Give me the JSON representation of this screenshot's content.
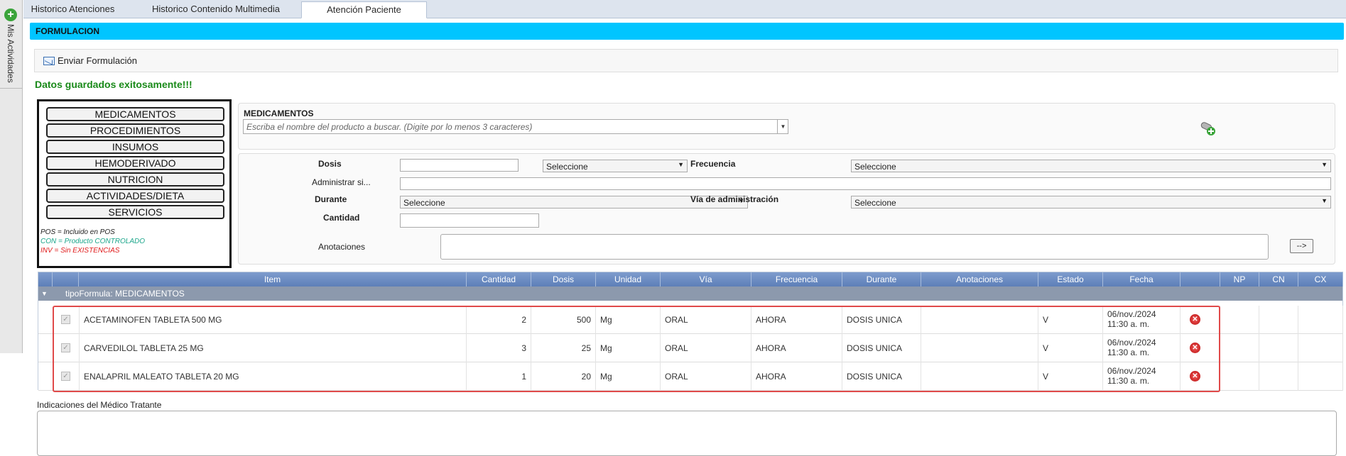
{
  "sidebar": {
    "label": "Mis Actividades"
  },
  "tabs": [
    {
      "label": "Historico Atenciones"
    },
    {
      "label": "Historico Contenido Multimedia"
    },
    {
      "label": "Atención Paciente"
    }
  ],
  "banner": {
    "title": "FORMULACION"
  },
  "toolbar": {
    "send_label": "Enviar Formulación"
  },
  "status": {
    "message": "Datos guardados exitosamente!!!"
  },
  "categories": [
    "MEDICAMENTOS",
    "PROCEDIMIENTOS",
    "INSUMOS",
    "HEMODERIVADO",
    "NUTRICION",
    "ACTIVIDADES/DIETA",
    "SERVICIOS"
  ],
  "legend": {
    "pos": "POS = Incluido en POS",
    "con": "CON = Producto CONTROLADO",
    "inv": "INV = Sin EXISTENCIAS",
    "colors": {
      "pos": "#222222",
      "con": "#1aa58a",
      "inv": "#e01b1b"
    }
  },
  "medicamentos": {
    "title": "MEDICAMENTOS",
    "search_placeholder": "Escriba el nombre del producto a buscar. (Digite por lo menos 3 caracteres)"
  },
  "form": {
    "dosis_label": "Dosis",
    "dosis_unit": "Seleccione",
    "frecuencia_label": "Frecuencia",
    "frecuencia_value": "Seleccione",
    "administrar_label": "Administrar si...",
    "durante_label": "Durante",
    "durante_value": "Seleccione",
    "via_label": "Vía de administración",
    "via_value": "Seleccione",
    "cantidad_label": "Cantidad",
    "anotaciones_label": "Anotaciones",
    "arrow_label": "-->"
  },
  "grid": {
    "headers": [
      "Item",
      "Cantidad",
      "Dosis",
      "Unidad",
      "Vía",
      "Frecuencia",
      "Durante",
      "Anotaciones",
      "Estado",
      "Fecha",
      "NP",
      "CN",
      "CX"
    ],
    "group_label": "tipoFormula: MEDICAMENTOS",
    "rows": [
      {
        "item": "ACETAMINOFEN TABLETA 500 MG",
        "cantidad": "2",
        "dosis": "500",
        "unidad": "Mg",
        "via": "ORAL",
        "frecuencia": "AHORA",
        "durante": "DOSIS UNICA",
        "anotaciones": "",
        "estado": "V",
        "fecha1": "06/nov./2024",
        "fecha2": "11:30 a. m."
      },
      {
        "item": "CARVEDILOL TABLETA 25 MG",
        "cantidad": "3",
        "dosis": "25",
        "unidad": "Mg",
        "via": "ORAL",
        "frecuencia": "AHORA",
        "durante": "DOSIS UNICA",
        "anotaciones": "",
        "estado": "V",
        "fecha1": "06/nov./2024",
        "fecha2": "11:30 a. m."
      },
      {
        "item": "ENALAPRIL MALEATO TABLETA 20 MG",
        "cantidad": "1",
        "dosis": "20",
        "unidad": "Mg",
        "via": "ORAL",
        "frecuencia": "AHORA",
        "durante": "DOSIS UNICA",
        "anotaciones": "",
        "estado": "V",
        "fecha1": "06/nov./2024",
        "fecha2": "11:30 a. m."
      }
    ]
  },
  "indicaciones": {
    "label": "Indicaciones del Médico Tratante"
  },
  "icons": {
    "add": "plus-circle-icon",
    "send": "mail-send-icon",
    "add_med": "pill-add-icon",
    "delete": "delete-icon"
  }
}
